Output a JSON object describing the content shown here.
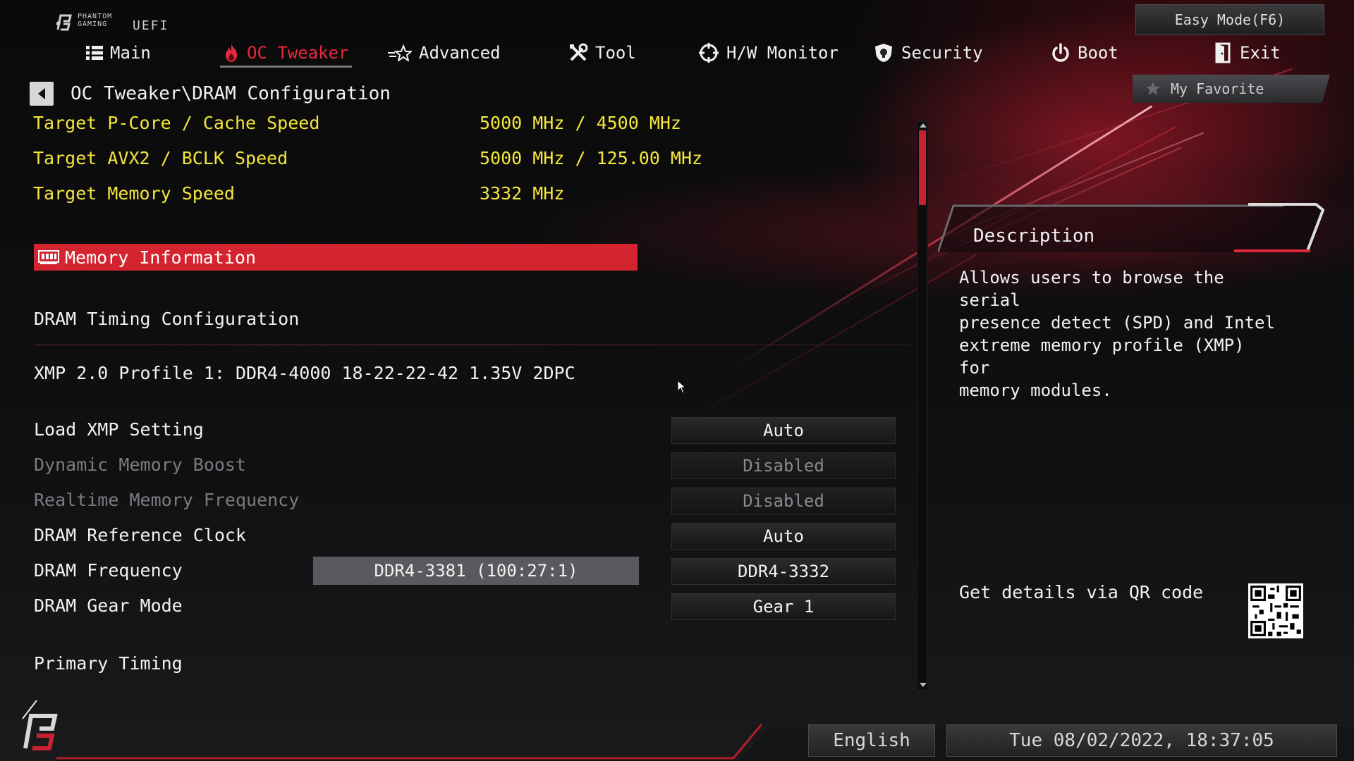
{
  "brand": {
    "line1": "PHANTOM",
    "line2": "GAMING",
    "uefi": "UEFI"
  },
  "easy_mode_label": "Easy Mode(F6)",
  "nav": [
    {
      "label": "Main",
      "icon": "list-icon",
      "active": false
    },
    {
      "label": "OC Tweaker",
      "icon": "flame-icon",
      "active": true
    },
    {
      "label": "Advanced",
      "icon": "star-icon",
      "active": false
    },
    {
      "label": "Tool",
      "icon": "tools-icon",
      "active": false
    },
    {
      "label": "H/W Monitor",
      "icon": "crosshair-icon",
      "active": false
    },
    {
      "label": "Security",
      "icon": "shield-icon",
      "active": false
    },
    {
      "label": "Boot",
      "icon": "power-icon",
      "active": false
    },
    {
      "label": "Exit",
      "icon": "exit-icon",
      "active": false
    }
  ],
  "breadcrumb": "OC Tweaker\\DRAM Configuration",
  "my_favorite_label": "My Favorite",
  "targets": [
    {
      "label": "Target P-Core / Cache Speed",
      "value": "5000 MHz / 4500 MHz"
    },
    {
      "label": "Target AVX2 / BCLK Speed",
      "value": "5000 MHz / 125.00 MHz"
    },
    {
      "label": "Target Memory Speed",
      "value": "3332 MHz"
    }
  ],
  "memory_information_label": "Memory Information",
  "dram_timing_label": "DRAM Timing Configuration",
  "xmp_profile": "XMP 2.0 Profile 1: DDR4-4000 18-22-22-42 1.35V 2DPC",
  "settings": [
    {
      "label": "Load XMP Setting",
      "value": "Auto",
      "enabled": true
    },
    {
      "label": "Dynamic Memory Boost",
      "value": "Disabled",
      "enabled": false
    },
    {
      "label": "Realtime Memory Frequency",
      "value": "Disabled",
      "enabled": false
    },
    {
      "label": "DRAM Reference Clock",
      "value": "Auto",
      "enabled": true
    },
    {
      "label": "DRAM Frequency",
      "value": "DDR4-3332",
      "enabled": true,
      "readout": "DDR4-3381 (100:27:1)"
    },
    {
      "label": "DRAM Gear Mode",
      "value": "Gear 1",
      "enabled": true
    }
  ],
  "primary_timing_label": "Primary Timing",
  "description": {
    "title": "Description",
    "text": "Allows users to browse the serial\npresence detect (SPD) and Intel\nextreme memory profile (XMP) for\nmemory modules."
  },
  "qr_label": "Get details via QR code",
  "footer": {
    "language": "English",
    "datetime": "Tue 08/02/2022, 18:37:05"
  },
  "colors": {
    "accent_red": "#d4242f",
    "target_yellow": "#f5e63a",
    "text": "#f2f2f2",
    "disabled": "#7c7c80"
  }
}
